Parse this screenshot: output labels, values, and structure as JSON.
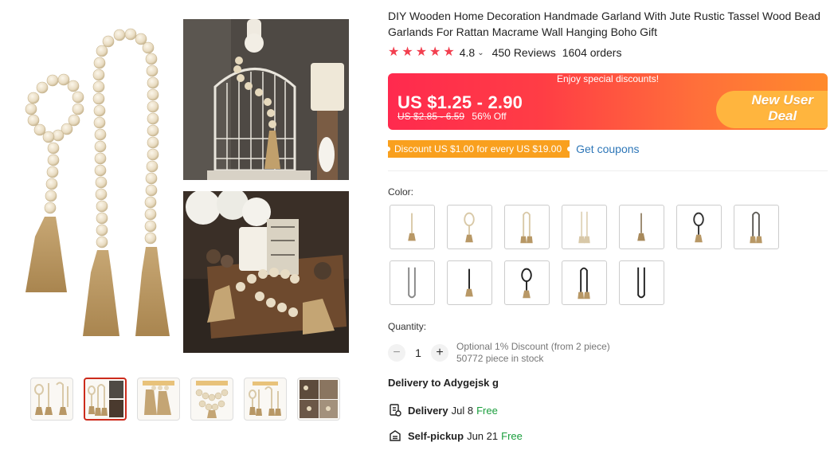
{
  "product": {
    "title": "DIY Wooden Home Decoration Handmade Garland With Jute Rustic Tassel Wood Bead Garlands For Rattan Macrame Wall Hanging Boho Gift",
    "rating": "4.8",
    "reviews": "450 Reviews",
    "orders": "1604 orders"
  },
  "price": {
    "banner_text": "Enjoy special discounts!",
    "range": "US $1.25 - 2.90",
    "old_range": "US $2.85 - 6.59",
    "discount": "56% Off",
    "new_user_line1": "New User",
    "new_user_line2": "Deal"
  },
  "coupon": {
    "tag": "Discount US $1.00 for every US $19.00",
    "link": "Get coupons"
  },
  "color": {
    "label": "Color:",
    "options": [
      "natural-short",
      "natural-loop",
      "natural-long",
      "natural-double",
      "dark-short",
      "black-loop",
      "dark-long",
      "grey-double",
      "black-short",
      "black-loop-2",
      "black-long",
      "black-double"
    ]
  },
  "quantity": {
    "label": "Quantity:",
    "value": "1",
    "discount_note": "Optional 1% Discount (from 2 piece)",
    "stock": "50772 piece in stock"
  },
  "delivery": {
    "to": "Delivery to Adygejsk g",
    "options": [
      {
        "type": "Delivery",
        "date": "Jul 8",
        "cost": "Free",
        "icon": "shipping-icon"
      },
      {
        "type": "Self-pickup",
        "date": "Jun 21",
        "cost": "Free",
        "icon": "pickup-icon"
      }
    ]
  },
  "colors": {
    "accent_red": "#f23f4f",
    "banner_start": "#ff2a4e",
    "banner_end": "#ff8a2c",
    "coupon_orange": "#f9a01e",
    "link_blue": "#2e77b8",
    "free_green": "#1a9e3c"
  }
}
